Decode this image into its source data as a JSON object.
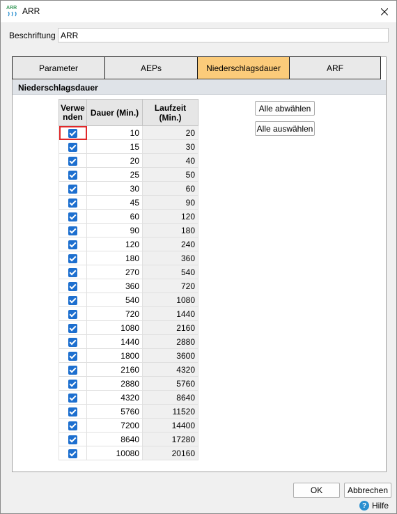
{
  "window": {
    "title": "ARR",
    "logo_text": "ARR"
  },
  "form": {
    "label": "Beschriftung",
    "value": "ARR"
  },
  "tabs": [
    {
      "label": "Parameter",
      "active": false
    },
    {
      "label": "AEPs",
      "active": false
    },
    {
      "label": "Niederschlagsdauer",
      "active": true
    },
    {
      "label": "ARF",
      "active": false
    }
  ],
  "section": {
    "title": "Niederschlagsdauer"
  },
  "table": {
    "headers": {
      "use": "Verwenden",
      "dauer": "Dauer (Min.)",
      "laufzeit": "Laufzeit (Min.)"
    },
    "rows": [
      {
        "checked": true,
        "dauer": "10",
        "laufzeit": "20"
      },
      {
        "checked": true,
        "dauer": "15",
        "laufzeit": "30"
      },
      {
        "checked": true,
        "dauer": "20",
        "laufzeit": "40"
      },
      {
        "checked": true,
        "dauer": "25",
        "laufzeit": "50"
      },
      {
        "checked": true,
        "dauer": "30",
        "laufzeit": "60"
      },
      {
        "checked": true,
        "dauer": "45",
        "laufzeit": "90"
      },
      {
        "checked": true,
        "dauer": "60",
        "laufzeit": "120"
      },
      {
        "checked": true,
        "dauer": "90",
        "laufzeit": "180"
      },
      {
        "checked": true,
        "dauer": "120",
        "laufzeit": "240"
      },
      {
        "checked": true,
        "dauer": "180",
        "laufzeit": "360"
      },
      {
        "checked": true,
        "dauer": "270",
        "laufzeit": "540"
      },
      {
        "checked": true,
        "dauer": "360",
        "laufzeit": "720"
      },
      {
        "checked": true,
        "dauer": "540",
        "laufzeit": "1080"
      },
      {
        "checked": true,
        "dauer": "720",
        "laufzeit": "1440"
      },
      {
        "checked": true,
        "dauer": "1080",
        "laufzeit": "2160"
      },
      {
        "checked": true,
        "dauer": "1440",
        "laufzeit": "2880"
      },
      {
        "checked": true,
        "dauer": "1800",
        "laufzeit": "3600"
      },
      {
        "checked": true,
        "dauer": "2160",
        "laufzeit": "4320"
      },
      {
        "checked": true,
        "dauer": "2880",
        "laufzeit": "5760"
      },
      {
        "checked": true,
        "dauer": "4320",
        "laufzeit": "8640"
      },
      {
        "checked": true,
        "dauer": "5760",
        "laufzeit": "11520"
      },
      {
        "checked": true,
        "dauer": "7200",
        "laufzeit": "14400"
      },
      {
        "checked": true,
        "dauer": "8640",
        "laufzeit": "17280"
      },
      {
        "checked": true,
        "dauer": "10080",
        "laufzeit": "20160"
      }
    ]
  },
  "buttons": {
    "deselect_all": "Alle abwählen",
    "select_all": "Alle auswählen",
    "ok": "OK",
    "cancel": "Abbrechen",
    "help": "Hilfe"
  },
  "colors": {
    "active_tab": "#fbcb7a",
    "checkbox": "#1d6fcf",
    "focus": "#e0282a",
    "help_icon": "#2a8fd0"
  }
}
